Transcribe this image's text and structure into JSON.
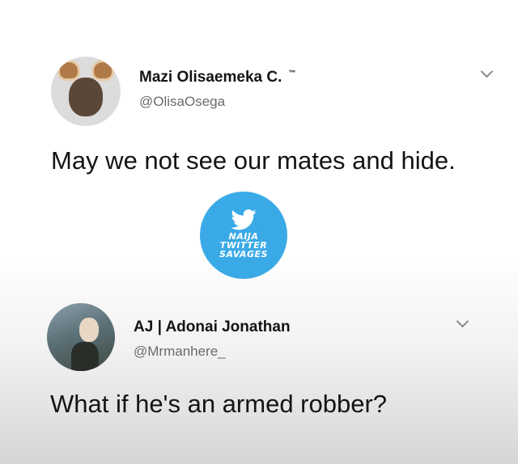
{
  "tweets": [
    {
      "name": "Mazi Olisaemeka C.",
      "name_suffix": "™",
      "handle": "@OlisaOsega",
      "text": "May we not see our mates and hide."
    },
    {
      "name": "AJ | Adonai Jonathan",
      "handle": "@Mrmanhere_",
      "text": "What if he's an armed robber?"
    }
  ],
  "watermark": {
    "icon": "twitter-bird-icon",
    "lines": [
      "NAIJA",
      "TWITTER",
      "SAVAGES"
    ],
    "color": "#2aa3e6"
  },
  "colors": {
    "text": "#141414",
    "handle": "#6b6b6b"
  }
}
